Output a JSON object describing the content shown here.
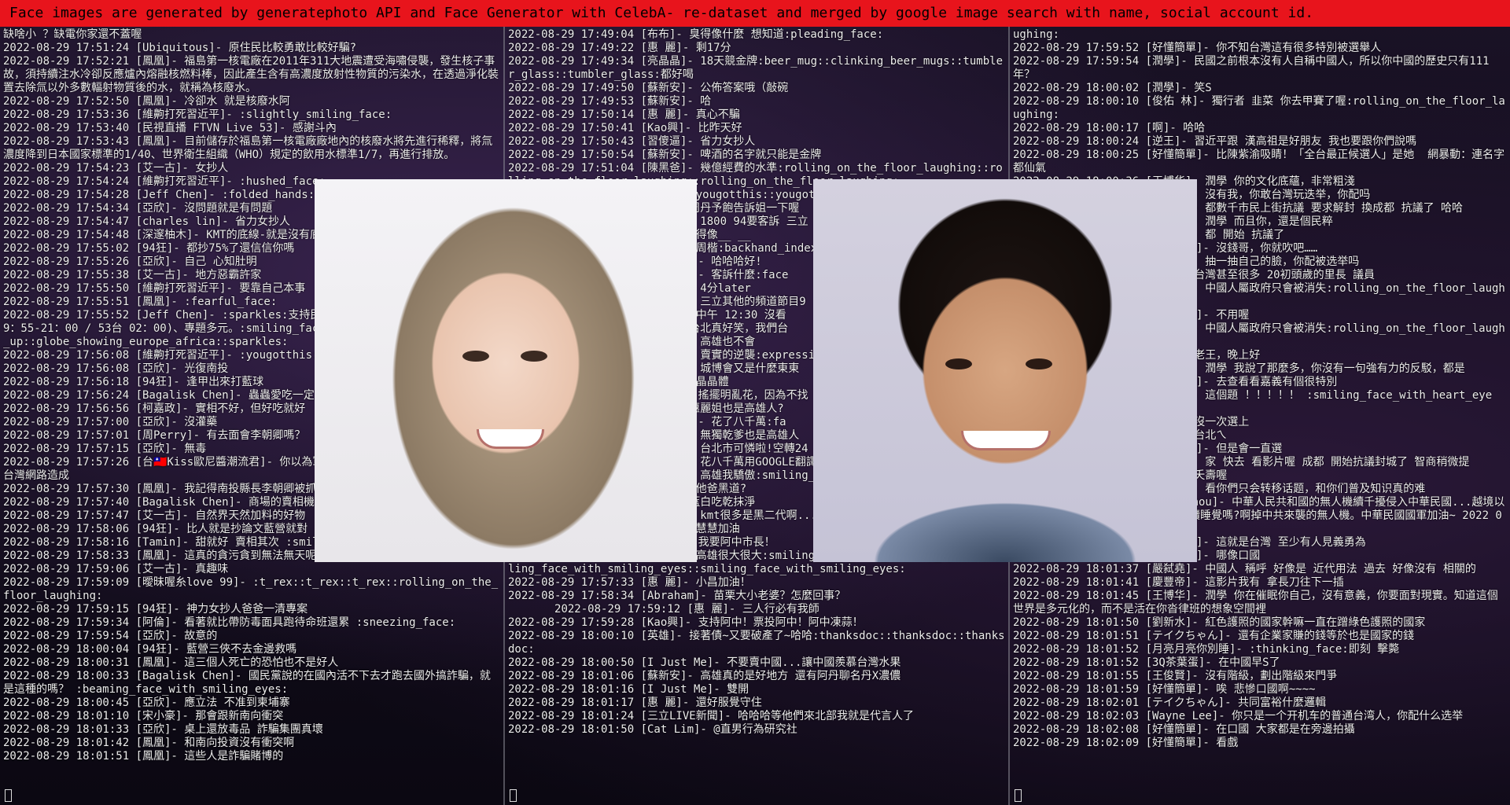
{
  "banner": "Face images are generated by generatephoto API and Face Generator with CelebA- re-dataset and merged by google image search with name, social account id.",
  "panes": {
    "left": [
      "缺啥小 ？缺電你家還不蓋喔",
      "2022-08-29 17:51:24 [Ubiquitous]- 原住民比較勇敢比較好騙?",
      "2022-08-29 17:52:21 [鳳凰]- 福島第一核電廠在2011年311大地震遭受海嘯侵襲，發生核子事故，須持續注水冷卻反應爐內熔融核燃料棒，因此產生含有高濃度放射性物質的污染水，在透過淨化裝置去除氚以外多數輻射物質後的水，就稱為核廢水。",
      "2022-08-29 17:52:50 [鳳凰]- 冷卻水 就是核廢水阿",
      "2022-08-29 17:53:36 [維齁打死習近平]- :slightly_smiling_face:",
      "2022-08-29 17:53:40 [民視直播 FTVN Live 53]- 感謝斗內",
      "2022-08-29 17:53:43 [鳳凰]- 目前儲存於福島第一核電廠廠地內的核廢水將先進行稀釋，將氚濃度降到日本國家標準的1/40、世界衛生組織（WHO）規定的飲用水標準1/7，再進行排放。",
      "2022-08-29 17:54:23 [艾一古]- 女抄人",
      "2022-08-29 17:54:24 [維齁打死習近平]- :hushed_face:",
      "2022-08-29 17:54:28 [Jeff Chen]- :folded_hands:",
      "2022-08-29 17:54:34 [亞欣]- 沒問題就是有問題",
      "2022-08-29 17:54:47 [charles lin]- 省力女抄人",
      "2022-08-29 17:54:48 [深邃柚木]- KMT的底線-就是沒有底線",
      "2022-08-29 17:55:02 [94狂]- 都抄75%了還信信你嗎",
      "2022-08-29 17:55:26 [亞欣]- 自己 心知肚明",
      "2022-08-29 17:55:38 [艾一古]- 地方惡霸許家",
      "2022-08-29 17:55:50 [維齁打死習近平]- 要靠自己本事",
      "2022-08-29 17:55:51 [鳳凰]- :fearful_face:",
      "2022-08-29 17:55:52 [Jeff Chen]- :sparkles:支持民視新聞 (週一～週五 / 152台 19：55-21：00 / 53台 02：00)、專題多元。:smiling_face_with_smiling_eyes::thumbs_up::globe_showing_europe_africa::sparkles:",
      "2022-08-29 17:56:08 [維齁打死習近平]- :yougotthis:",
      "2022-08-29 17:56:08 [亞欣]- 光復南投",
      "2022-08-29 17:56:18 [94狂]- 逢甲出來打藍球",
      "2022-08-29 17:56:24 [Bagalisk Chen]- 蟲蟲愛吃一定是",
      "2022-08-29 17:56:56 [柯嘉政]- 實相不好，但好吃就好",
      "2022-08-29 17:57:00 [亞欣]- 沒灌藥",
      "2022-08-29 17:57:01 [周Perry]- 有去面會李朝卿嗎？",
      "2022-08-29 17:57:15 [亞欣]- 無毒",
      "2022-08-29 17:57:26 [台🇹🇼Kiss歐尼醬潮流君]- 你以為軍機台灣，沒想到香港幫助解放軍破解台灣網路造成",
      "2022-08-29 17:57:30 [鳳凰]- 我記得南投縣長李朝卿被抓",
      "2022-08-29 17:57:40 [Bagalisk Chen]- 商場的賣相機",
      "2022-08-29 17:57:47 [艾一古]- 自然界天然加料的好物",
      "2022-08-29 17:58:06 [94狂]- 比人就是抄論文藍營就對",
      "2022-08-29 17:58:16 [Tamin]- 甜就好 賣相其次 :smiling_face:",
      "2022-08-29 17:58:33 [鳳凰]- 這真的貪污貪到無法無天呢",
      "2022-08-29 17:59:06 [艾一古]- 真趣味",
      "2022-08-29 17:59:09 [曖昧喔糸love 99]- :t_rex::t_rex::t_rex::rolling_on_the_floor_laughing:",
      "2022-08-29 17:59:15 [94狂]- 神力女抄人爸爸一清專案",
      "2022-08-29 17:59:34 [阿倫]- 看著就比帶防毒面具跑待命班還累 :sneezing_face:",
      "2022-08-29 17:59:54 [亞欣]- 故意的",
      "2022-08-29 18:00:04 [94狂]- 藍營三俠不去金邊救嗎",
      "2022-08-29 18:00:31 [鳳凰]- 這三個人死亡的恐怕也不是好人",
      "2022-08-29 18:00:33 [Bagalisk Chen]- 國民黨說的在國內活不下去才跑去國外搞詐騙，就是這種的嗎？ :beaming_face_with_smiling_eyes:",
      "2022-08-29 18:00:45 [亞欣]- 應立法 不准到柬埔寨",
      "2022-08-29 18:01:10 [宋小豪]- 那會跟新南向衝突",
      "2022-08-29 18:01:33 [亞欣]- 桌上還放毒品 詐騙集團真壞",
      "2022-08-29 18:01:42 [鳳凰]- 和南向投資沒有衝突啊",
      "2022-08-29 18:01:51 [鳳凰]- 這些人是詐騙賭博的"
    ],
    "middle": [
      "2022-08-29 17:49:04 [布布]- 臭得像什麼 想知道:pleading_face:",
      "2022-08-29 17:49:22 [惠 麗]- 剩17分",
      "2022-08-29 17:49:34 [亮晶晶]- 18天競金牌:beer_mug::clinking_beer_mugs::tumbler_glass::tumbler_glass:都好喝",
      "2022-08-29 17:49:50 [蘇新安]- 公佈答案哦（敲碗",
      "2022-08-29 17:49:53 [蘇新安]- 哈",
      "2022-08-29 17:50:14 [惠 麗]- 真心不騙",
      "2022-08-29 17:50:41 [Kao興]- 比昨天好",
      "2022-08-29 17:50:43 [習傻逼]- 省力女抄人",
      "2022-08-29 17:50:54 [蘇新安]- 啤酒的名字就只能是金牌",
      "2022-08-29 17:51:04 [陳黑爸]- 幾億經費的水準:rolling_on_the_floor_laughing::rolling_on_the_floor_laughing::rolling_on_the_floor_laughing:",
      "2022-08-29 17:51:20 [周凱]- :yougotthis::yougotthis:",
      "2022-08-29 17:51:28 [周丹]- 周丹予飽告訴姐一下喔",
      "2022-08-29 17:51:43 [蘇新安]- 1800 94要客訴 三立",
      "2022-08-29 17:51:52 [惠 麗]- 得像__ __",
      "2022-08-29 17:52:02 [周楷]- @周楷:backhand_index_pointing_left:",
      "2022-08-29 17:52:11 [民視新聞]- 哈哈哈好!",
      "2022-08-29 17:52:24 [三立新聞]- 客訴什麼:face",
      "2022-08-29 17:52:40 [蘇新安]- 4分later",
      "2022-08-29 17:52:55 [陳黑爸]- 三立其他的頻道節目9",
      "2022-08-29 17:53:01 [惠 麗]- 中午 12:30 沒看",
      "2022-08-29 17:53:14 [布布]- 台北真好笑，我們台",
      "2022-08-29 17:53:20 [亮晶晶]- 高雄也不會",
      "2022-08-29 17:53:35 [習傻逼]- 賣實的逆襲:expressio",
      "2022-08-29 17:53:44 [蘇新安]- 城博會又是什麼東東",
      "2022-08-29 17:53:52 [惠 麗]- 晶晶體",
      "2022-08-29 17:54:03 [Kao興]- 搖擺明亂花，因為不找",
      "2022-08-29 17:54:11 [周凱]- 惠麗姐也是高雄人?",
      "2022-08-29 17:54:25 [三立新聞]- 花了八千萬:fa",
      "2022-08-29 17:54:30 [陳黑爸]- 無獨乾爹也是高雄人",
      "2022-08-29 17:54:41 [習傻逼]- 台北市可憐啦!空轉24",
      "2022-08-29 17:54:52 [亮晶晶]- 花八千萬用GOOGLE翻譯",
      "2022-08-29 17:55:03 [蘇新安]- 高雄我驕傲:smiling_face_with_heart_eyes:",
      "2022-08-29 17:55:17 [惠 麗]- 他爸黑道?",
      "2022-08-29 17:55:30 [周丹]- 藍白吃乾抹淨",
      "2022-08-29 17:56:31 [吳宗龍]- kmt很多是黑二代啊...",
      "2022-08-29 17:56:36 [惠 麗]- 慧慧加油",
      "2022-08-29 17:57:01 [Kao興]- 我要阿中市長！",
      "2022-08-29 17:57:09 [惠 麗]- 高雄很大很大:smiling_face_with_smiling_eyes::smiling_face_with_smiling_eyes::smiling_face_with_smiling_eyes:",
      "2022-08-29 17:57:33 [惠 麗]- 小昌加油！",
      "2022-08-29 17:58:34 [Abraham]- 苗栗大小老婆？怎麼回事？",
      "       2022-08-29 17:59:12 [惠 麗]- 三人行必有我師",
      "2022-08-29 17:59:28 [Kao興]- 支持阿中！票投阿中！阿中凍蒜！",
      "2022-08-29 18:00:10 [英雄]- 接著債~又要破產了~哈哈:thanksdoc::thanksdoc::thanksdoc:",
      "2022-08-29 18:00:50 [I Just Me]- 不要賣中國...讓中國羨慕台灣水果",
      "2022-08-29 18:01:06 [蘇新安]- 高雄真的是好地方 還有阿丹聊名丹X濃儂",
      "2022-08-29 18:01:16 [I Just Me]- 雙開",
      "2022-08-29 18:01:17 [惠 麗]- 還好服覺守住",
      "2022-08-29 18:01:24 [三立LIVE新聞]- 哈哈哈等他們來北部我就是代言人了",
      "2022-08-29 18:01:50 [Cat Lim]- @直男行為研究社"
    ],
    "right": [
      "ughing:",
      "2022-08-29 17:59:52 [好懂簡單]- 你不知台灣這有很多特別被選舉人",
      "2022-08-29 17:59:54 [潤學]- 民國之前根本沒有人自稱中國人，所以你中國的歷史只有111年？",
      "2022-08-29 18:00:02 [潤學]- 笑S",
      "2022-08-29 18:00:10 [俊佑 林]- 獨行者 韭菜 你去甲賽了喔:rolling_on_the_floor_laughing:",
      "2022-08-29 18:00:17 [啊]- 哈哈",
      "2022-08-29 18:00:24 [逆王]- 習近平跟 漢高祖是好朋友 我也要跟你們說嗎",
      "2022-08-29 18:00:25 [好懂簡單]- 比陳紫渝吸睛！「全台最正候選人」是她  網暴動：連名字都仙氣",
      "2022-08-29 18:00:36 [王博华]- 潤學 你的文化底蘊，非常粗淺",
      "2022-08-29 18:00:41 [獨行者]- 沒有我，你敢台灣玩迭举，你配吗",
      "2022-08-29 18:00:47 [王博华]- 都數千市民上街抗議 要求解封 換成都 抗議了 哈哈",
      "2022-08-29 18:00:52 [獨行者]- 潤學 而且你，還是個民粹",
      "2022-08-29 18:00:58 [王博华]- 都 開始 抗議了",
      "2022-08-29 18:01:02 [好懂簡單]- 沒錢哥，你就吹吧……",
      "2022-08-29 18:01:05 [獨行者]- 抽一抽自己的臉，你配被选举吗",
      "2022-08-29 18:01:07 [逆王]- 台灣甚至很多 20初頭歲的里長 議員",
      "2022-08-29 18:01:09 [王博华]- 中國人屬政府只會被消失:rolling_on_the_floor_laughing:",
      "2022-08-29 18:01:11 [好懂簡單]- 不用喔",
      "2022-08-29 18:01:12 [王博华]- 中國人屬政府只會被消失:rolling_on_the_floor_laughing:",
      "2022-08-29 18:01:13 [逆王]- 老王，晚上好",
      "2022-08-29 18:01:14 [獨行者]- 潤學 我說了那麼多，你沒有一句強有力的反駁，都是",
      "2022-08-29 18:01:15 [好懂簡單]- 去查看看嘉義有個很特別",
      "2022-08-29 18:01:16 [王博华]- 這個題 ！！！！！ :smiling_face_with_heart_eyes::fire::fire:",
      "2022-08-29 18:01:17 [逆王]- 沒一次選上",
      "2022-08-29 18:01:18 [潤學]- 台北ㄟ",
      "2022-08-29 18:01:19 [好懂簡單]- 但是會一直選",
      "2022-08-29 18:01:20 [王博华]- 家 快去 看影片喔 成都 開始抗議封城了 智商稍微提",
      "2022-08-29 18:01:21 [逆王]- 夭壽喔",
      "2022-08-29 18:01:22 [獨行者]- 看你們只会转移话题，和你们普及知识真的难",
      "2022-08-29 18:01:23 [kang chou]- 中華人民共和國的無人機續千擾侵入中華民國...越境以可惡至極點，中華民國國防部要再繼續睡覺嗎?啊掉中共來襲的無人機。中華民國國軍加油~ 2022 0829",
      "2022-08-29 18:01:33 [好懂簡單]- 這就是台灣 至少有人見義勇為",
      "2022-08-29 18:01:36 [好懂簡單]- 哪像口國",
      "2022-08-29 18:01:37 [嚴弑堯]- 中國人 稱呼 好像是 近代用法 過去 好像沒有 相關的",
      "2022-08-29 18:01:41 [慶豐帝]- 這影片我有 拿長刀往下一插",
      "2022-08-29 18:01:45 [王博华]- 潤學 你在催眠你自己，沒有意義，你要面對現實。知道這個世界是多元化的，而不是活在你沓律班的想象空間裡",
      "2022-08-29 18:01:50 [劉新水]- 紅色護照的國家幹嘛一直在蹭綠色護照的國家",
      "2022-08-29 18:01:51 [テイクちゃん]- 還有企業家賺的錢等於也是國家的錢",
      "2022-08-29 18:01:52 [月亮月亮你別睡]- :thinking_face:即刻 擊斃",
      "2022-08-29 18:01:52 [3Q茶葉蛋]- 在中國早S了",
      "2022-08-29 18:01:55 [王俊賢]- 沒有階級，劃出階級來門爭",
      "2022-08-29 18:01:59 [好懂簡單]- 唉 悲慘口國啊~~~~",
      "2022-08-29 18:02:01 [テイクちゃん]- 共同富裕什麼邏輯",
      "2022-08-29 18:02:03 [Wayne Lee]- 你只是一个开机车的普通台湾人，你配什么选举",
      "2022-08-29 18:02:08 [好懂簡單]- 在口國 大家都是在旁邊拍攝",
      "2022-08-29 18:02:09 [好懂簡單]- 看戲"
    ]
  },
  "photos": {
    "left_face": "female portrait face image",
    "right_face": "female portrait face image"
  },
  "colors": {
    "banner_bg": "#e8141c",
    "text": "#ececec"
  }
}
